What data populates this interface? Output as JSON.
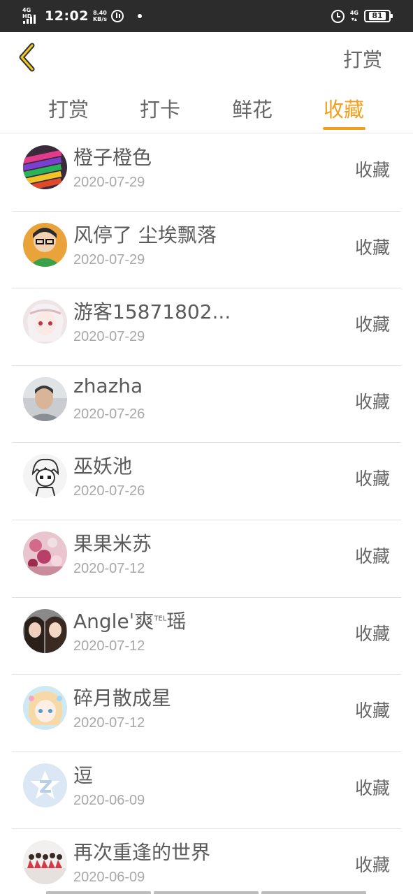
{
  "status_bar": {
    "network": "4G HD",
    "time": "12:02",
    "speed_value": "8.40",
    "speed_unit": "KB/s",
    "network2": "4G",
    "battery": "81"
  },
  "header": {
    "back_icon": "chevron-left-icon",
    "action_label": "打赏"
  },
  "tabs": [
    {
      "label": "打赏",
      "active": false
    },
    {
      "label": "打卡",
      "active": false
    },
    {
      "label": "鲜花",
      "active": false
    },
    {
      "label": "收藏",
      "active": true
    }
  ],
  "accent_color": "#f0a01e",
  "list": [
    {
      "name": "橙子橙色",
      "date": "2020-07-29",
      "type": "收藏",
      "avatar": "colored-crayons-avatar"
    },
    {
      "name": "风停了 尘埃飘落",
      "date": "2020-07-29",
      "type": "收藏",
      "avatar": "boy-glasses-avatar"
    },
    {
      "name": "游客15871802...",
      "date": "2020-07-29",
      "type": "收藏",
      "avatar": "anime-girl-avatar"
    },
    {
      "name": "zhazha",
      "date": "2020-07-26",
      "type": "收藏",
      "avatar": "man-photo-avatar"
    },
    {
      "name": "巫妖池",
      "date": "2020-07-26",
      "type": "收藏",
      "avatar": "sketch-character-avatar"
    },
    {
      "name": "果果米苏",
      "date": "2020-07-12",
      "type": "收藏",
      "avatar": "pink-flowers-avatar"
    },
    {
      "name": "Angleˈ爽",
      "name_sup": "TEL",
      "name_tail": "瑶",
      "date": "2020-07-12",
      "type": "收藏",
      "avatar": "two-girls-avatar"
    },
    {
      "name": "碎月散成星",
      "date": "2020-07-12",
      "type": "收藏",
      "avatar": "anime-pastel-avatar"
    },
    {
      "name": "逗",
      "date": "2020-06-09",
      "type": "收藏",
      "avatar": "default-star-avatar"
    },
    {
      "name": "再次重逢的世界",
      "date": "2020-06-09",
      "type": "收藏",
      "avatar": "group-photo-avatar"
    }
  ]
}
